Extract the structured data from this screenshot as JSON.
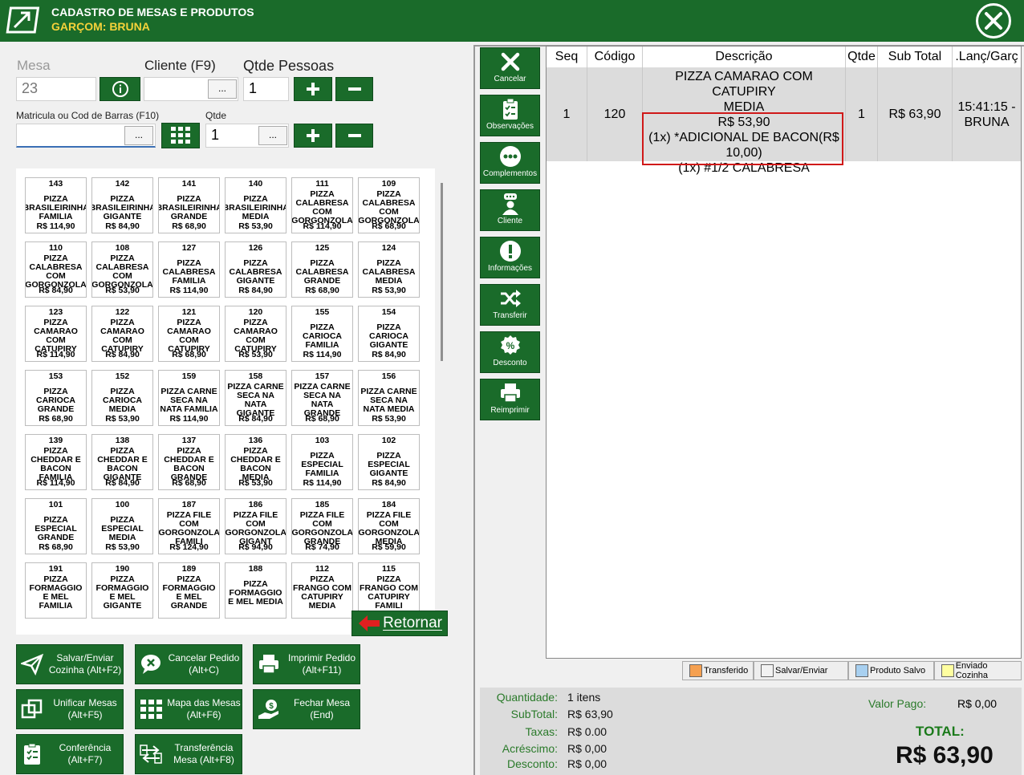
{
  "header": {
    "title": "CADASTRO DE MESAS E PRODUTOS",
    "waiter": "GARÇOM: BRUNA"
  },
  "form": {
    "mesa_label": "Mesa",
    "mesa_value": "23",
    "cliente_label": "Cliente (F9)",
    "cliente_value": "",
    "qtde_pessoas_label": "Qtde Pessoas",
    "qtde_pessoas_value": "1",
    "matricula_label": "Matricula ou Cod de Barras (F10)",
    "matricula_value": "",
    "qtde_label": "Qtde",
    "qtde_value": "1",
    "dots": "..."
  },
  "products": [
    {
      "code": "143",
      "name": "PIZZA BRASILEIRINHA FAMILIA",
      "price": "R$ 114,90"
    },
    {
      "code": "142",
      "name": "PIZZA BRASILEIRINHA GIGANTE",
      "price": "R$ 84,90"
    },
    {
      "code": "141",
      "name": "PIZZA BRASILEIRINHA GRANDE",
      "price": "R$ 68,90"
    },
    {
      "code": "140",
      "name": "PIZZA BRASILEIRINHA MEDIA",
      "price": "R$ 53,90"
    },
    {
      "code": "111",
      "name": "PIZZA CALABRESA COM GORGONZOLA",
      "price": "R$ 114,90"
    },
    {
      "code": "109",
      "name": "PIZZA CALABRESA COM GORGONZOLA",
      "price": "R$ 68,90"
    },
    {
      "code": "110",
      "name": "PIZZA CALABRESA COM GORGONZOLA",
      "price": "R$ 84,90"
    },
    {
      "code": "108",
      "name": "PIZZA CALABRESA COM GORGONZOLA",
      "price": "R$ 53,90"
    },
    {
      "code": "127",
      "name": "PIZZA CALABRESA FAMILIA",
      "price": "R$ 114,90"
    },
    {
      "code": "126",
      "name": "PIZZA CALABRESA GIGANTE",
      "price": "R$ 84,90"
    },
    {
      "code": "125",
      "name": "PIZZA CALABRESA GRANDE",
      "price": "R$ 68,90"
    },
    {
      "code": "124",
      "name": "PIZZA CALABRESA MEDIA",
      "price": "R$ 53,90"
    },
    {
      "code": "123",
      "name": "PIZZA CAMARAO COM CATUPIRY",
      "price": "R$ 114,90"
    },
    {
      "code": "122",
      "name": "PIZZA CAMARAO COM CATUPIRY",
      "price": "R$ 84,90"
    },
    {
      "code": "121",
      "name": "PIZZA CAMARAO COM CATUPIRY",
      "price": "R$ 68,90"
    },
    {
      "code": "120",
      "name": "PIZZA CAMARAO COM CATUPIRY",
      "price": "R$ 53,90"
    },
    {
      "code": "155",
      "name": "PIZZA CARIOCA FAMILIA",
      "price": "R$ 114,90"
    },
    {
      "code": "154",
      "name": "PIZZA CARIOCA GIGANTE",
      "price": "R$ 84,90"
    },
    {
      "code": "153",
      "name": "PIZZA CARIOCA GRANDE",
      "price": "R$ 68,90"
    },
    {
      "code": "152",
      "name": "PIZZA CARIOCA MEDIA",
      "price": "R$ 53,90"
    },
    {
      "code": "159",
      "name": "PIZZA CARNE SECA NA NATA FAMILIA",
      "price": "R$ 114,90"
    },
    {
      "code": "158",
      "name": "PIZZA CARNE SECA NA NATA GIGANTE",
      "price": "R$ 84,90"
    },
    {
      "code": "157",
      "name": "PIZZA CARNE SECA NA NATA GRANDE",
      "price": "R$ 68,90"
    },
    {
      "code": "156",
      "name": "PIZZA CARNE SECA NA NATA MEDIA",
      "price": "R$ 53,90"
    },
    {
      "code": "139",
      "name": "PIZZA CHEDDAR E BACON FAMILIA",
      "price": "R$ 114,90"
    },
    {
      "code": "138",
      "name": "PIZZA CHEDDAR E BACON GIGANTE",
      "price": "R$ 84,90"
    },
    {
      "code": "137",
      "name": "PIZZA CHEDDAR E BACON GRANDE",
      "price": "R$ 68,90"
    },
    {
      "code": "136",
      "name": "PIZZA CHEDDAR E BACON MEDIA",
      "price": "R$ 53,90"
    },
    {
      "code": "103",
      "name": "PIZZA ESPECIAL FAMILIA",
      "price": "R$ 114,90"
    },
    {
      "code": "102",
      "name": "PIZZA ESPECIAL GIGANTE",
      "price": "R$ 84,90"
    },
    {
      "code": "101",
      "name": "PIZZA ESPECIAL GRANDE",
      "price": "R$ 68,90"
    },
    {
      "code": "100",
      "name": "PIZZA ESPECIAL MEDIA",
      "price": "R$ 53,90"
    },
    {
      "code": "187",
      "name": "PIZZA FILE COM GORGONZOLA FAMILI",
      "price": "R$ 124,90"
    },
    {
      "code": "186",
      "name": "PIZZA FILE COM GORGONZOLA GIGANT",
      "price": "R$ 94,90"
    },
    {
      "code": "185",
      "name": "PIZZA FILE COM GORGONZOLA GRANDE",
      "price": "R$ 74,90"
    },
    {
      "code": "184",
      "name": "PIZZA FILE COM GORGONZOLA MEDIA",
      "price": "R$ 59,90"
    },
    {
      "code": "191",
      "name": "PIZZA FORMAGGIO E MEL FAMILIA",
      "price": ""
    },
    {
      "code": "190",
      "name": "PIZZA FORMAGGIO E MEL GIGANTE",
      "price": ""
    },
    {
      "code": "189",
      "name": "PIZZA FORMAGGIO E MEL GRANDE",
      "price": ""
    },
    {
      "code": "188",
      "name": "PIZZA FORMAGGIO E MEL MEDIA",
      "price": ""
    },
    {
      "code": "112",
      "name": "PIZZA FRANGO COM CATUPIRY MEDIA",
      "price": ""
    },
    {
      "code": "115",
      "name": "PIZZA FRANGO COM CATUPIRY FAMILI",
      "price": ""
    }
  ],
  "back_button": "Retornar",
  "actions": [
    {
      "label": "Salvar/Enviar Cozinha (Alt+F2)",
      "icon": "send-icon"
    },
    {
      "label": "Cancelar Pedido (Alt+C)",
      "icon": "cancel-chat-icon"
    },
    {
      "label": "Imprimir Pedido (Alt+F11)",
      "icon": "printer-icon"
    },
    {
      "label": "Unificar Mesas (Alt+F5)",
      "icon": "unify-icon"
    },
    {
      "label": "Mapa das Mesas (Alt+F6)",
      "icon": "grid-icon"
    },
    {
      "label": "Fechar Mesa (End)",
      "icon": "payment-icon"
    },
    {
      "label": "Conferência (Alt+F7)",
      "icon": "checklist-icon"
    },
    {
      "label": "Transferência Mesa (Alt+F8)",
      "icon": "transfer-icon"
    }
  ],
  "side_buttons": [
    {
      "label": "Cancelar",
      "icon": "x-icon"
    },
    {
      "label": "Observações",
      "icon": "clipboard-icon"
    },
    {
      "label": "Complementos",
      "icon": "more-icon"
    },
    {
      "label": "Cliente",
      "icon": "user-icon"
    },
    {
      "label": "Informações",
      "icon": "alert-icon"
    },
    {
      "label": "Transferir",
      "icon": "shuffle-icon"
    },
    {
      "label": "Desconto",
      "icon": "percent-icon"
    },
    {
      "label": "Reimprimir",
      "icon": "printer-icon"
    }
  ],
  "grid": {
    "columns": [
      "Seq",
      "Código",
      "Descrição",
      "Qtde",
      "Sub Total",
      ".Lanç/Garç"
    ],
    "rows": [
      {
        "seq": "1",
        "codigo": "120",
        "desc1": "PIZZA CAMARAO COM CATUPIRY",
        "desc2": "MEDIA",
        "desc3": "R$ 53,90",
        "desc4": "(1x) *ADICIONAL DE BACON(R$",
        "desc5": "10,00)",
        "desc6": "(1x) #1/2 CALABRESA",
        "qtde": "1",
        "subtotal": "R$ 63,90",
        "lanc1": "15:41:15 -",
        "lanc2": "BRUNA"
      }
    ]
  },
  "legend": [
    {
      "label": "Transferido",
      "color": "#f5a050"
    },
    {
      "label": "Salvar/Enviar",
      "color": "#f2f2f2"
    },
    {
      "label": "Produto Salvo",
      "color": "#a8d0f0"
    },
    {
      "label": "Enviado Cozinha",
      "color": "#ffffa0"
    }
  ],
  "totals": {
    "quantidade_label": "Quantidade:",
    "quantidade": "1 itens",
    "subtotal_label": "SubTotal:",
    "subtotal": "R$ 63,90",
    "taxas_label": "Taxas:",
    "taxas": "R$ 0.00",
    "acrescimo_label": "Acréscimo:",
    "acrescimo": "R$ 0,00",
    "desconto_label": "Desconto:",
    "desconto": "R$ 0,00",
    "valor_pago_label": "Valor Pago:",
    "valor_pago": "R$ 0,00",
    "total_label": "TOTAL:",
    "total": "R$ 63,90"
  },
  "colors": {
    "brand": "#1a6b2a",
    "waiter": "#f5d23a",
    "highlight": "#d01919"
  }
}
